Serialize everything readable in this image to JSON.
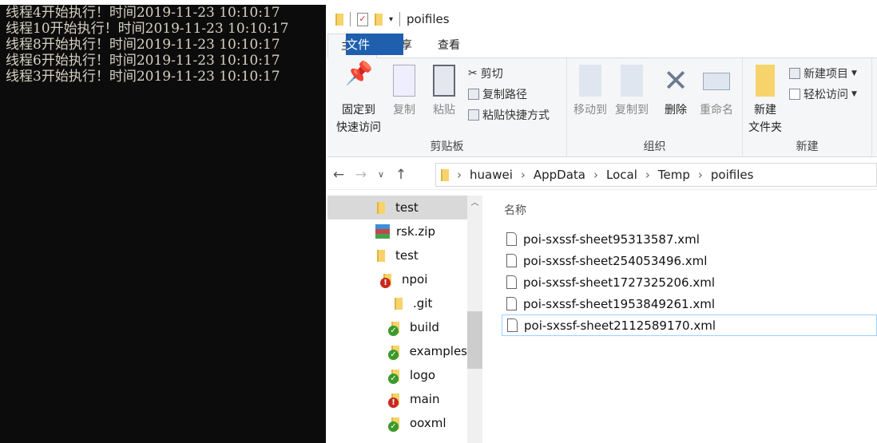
{
  "console": {
    "lines": [
      "线程4开始执行！时间2019-11-23 10:10:17",
      "线程10开始执行！时间2019-11-23 10:10:17",
      "线程8开始执行！时间2019-11-23 10:10:17",
      "线程6开始执行！时间2019-11-23 10:10:17",
      "线程3开始执行！时间2019-11-23 10:10:17"
    ]
  },
  "explorer": {
    "title": "poifiles",
    "tabs": [
      "文件",
      "主页",
      "共享",
      "查看"
    ],
    "ribbon": {
      "clipboard": {
        "label": "剪贴板",
        "pin": "固定到\n快速访问",
        "copy": "复制",
        "paste": "粘贴",
        "cut": "剪切",
        "copy_path": "复制路径",
        "paste_shortcut": "粘贴快捷方式"
      },
      "organize": {
        "label": "组织",
        "move_to": "移动到",
        "copy_to": "复制到",
        "delete": "删除",
        "rename": "重命名"
      },
      "new": {
        "label": "新建",
        "new_folder": "新建\n文件夹",
        "new_item": "新建项目",
        "easy_access": "轻松访问"
      }
    },
    "address": [
      "huawei",
      "AppData",
      "Local",
      "Temp",
      "poifiles"
    ],
    "tree": [
      {
        "label": "test",
        "icon": "folder",
        "badge": null
      },
      {
        "label": "rsk.zip",
        "icon": "zip",
        "badge": null
      },
      {
        "label": "test",
        "icon": "folder",
        "badge": null
      },
      {
        "label": "npoi",
        "icon": "folder",
        "badge": "error"
      },
      {
        "label": ".git",
        "icon": "folder",
        "badge": null
      },
      {
        "label": "build",
        "icon": "folder",
        "badge": "ok"
      },
      {
        "label": "examples",
        "icon": "folder",
        "badge": "ok"
      },
      {
        "label": "logo",
        "icon": "folder",
        "badge": "ok"
      },
      {
        "label": "main",
        "icon": "folder",
        "badge": "error"
      },
      {
        "label": "ooxml",
        "icon": "folder",
        "badge": "ok"
      }
    ],
    "column_name": "名称",
    "files": [
      "poi-sxssf-sheet95313587.xml",
      "poi-sxssf-sheet254053496.xml",
      "poi-sxssf-sheet1727325206.xml",
      "poi-sxssf-sheet1953849261.xml",
      "poi-sxssf-sheet2112589170.xml"
    ]
  }
}
